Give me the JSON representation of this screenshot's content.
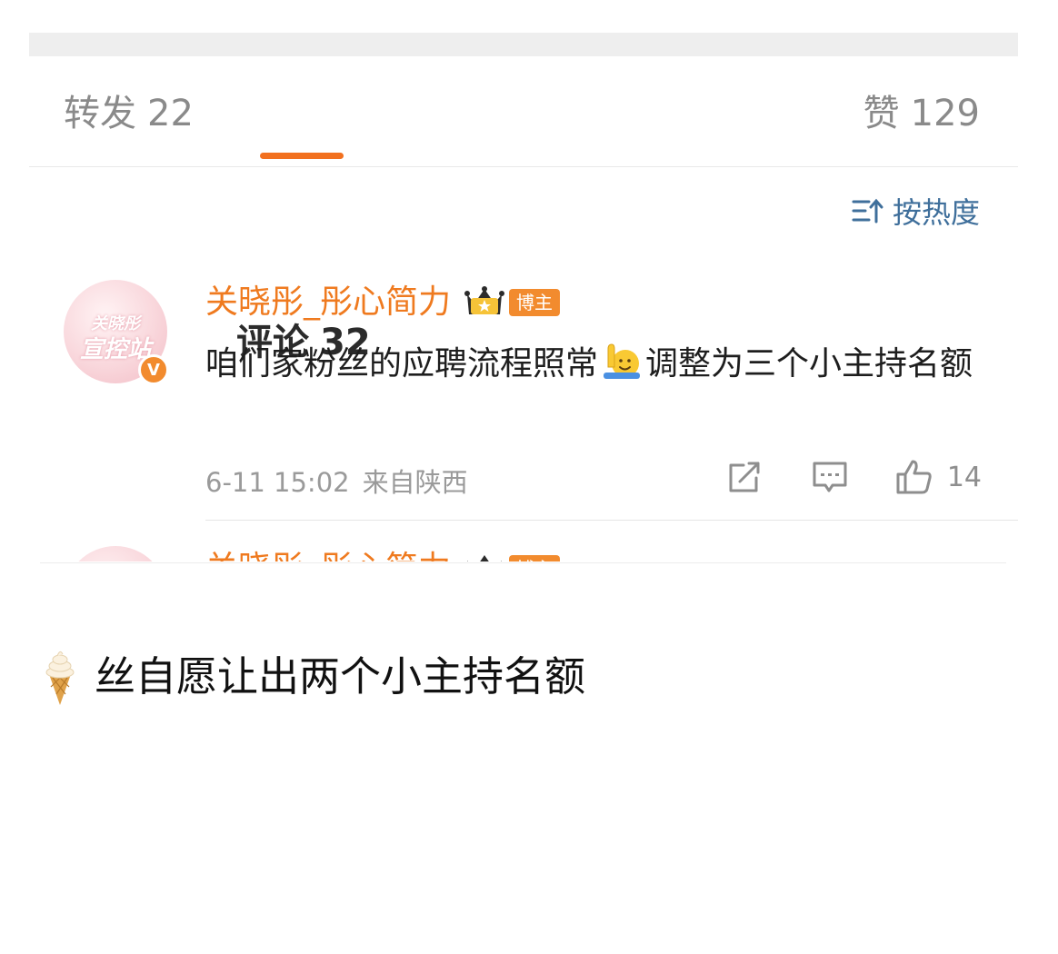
{
  "tabs": {
    "repost": {
      "label": "转发",
      "count": "22"
    },
    "comment": {
      "label": "评论",
      "count": "32"
    },
    "like": {
      "label": "赞",
      "count": "129"
    }
  },
  "sort": {
    "label": "按热度",
    "icon": "sort-icon"
  },
  "comment": {
    "username": "关晓彤_彤心简力",
    "avatar_watermark_line1": "关晓彤",
    "avatar_watermark_line2": "宣控站",
    "verified_badge": "V",
    "badge_label": "博主",
    "text_before_emoji": "咱们家粉丝的应聘流程照常",
    "emoji": "raising-hand-emoji",
    "text_after_emoji": "调整为三个小主持名额",
    "timestamp": "6-11 15:02",
    "source": "来自陕西",
    "like_count": "14"
  },
  "peek_comment": {
    "username": "关晓彤_彤心简力",
    "badge_label": "博主"
  },
  "caption": {
    "emoji": "ice-cream-emoji",
    "text": "丝自愿让出两个小主持名额"
  },
  "colors": {
    "accent": "#f2701f",
    "username": "#ef7a1f",
    "link_blue": "#3f6f9b",
    "muted": "#9a9a9a"
  }
}
